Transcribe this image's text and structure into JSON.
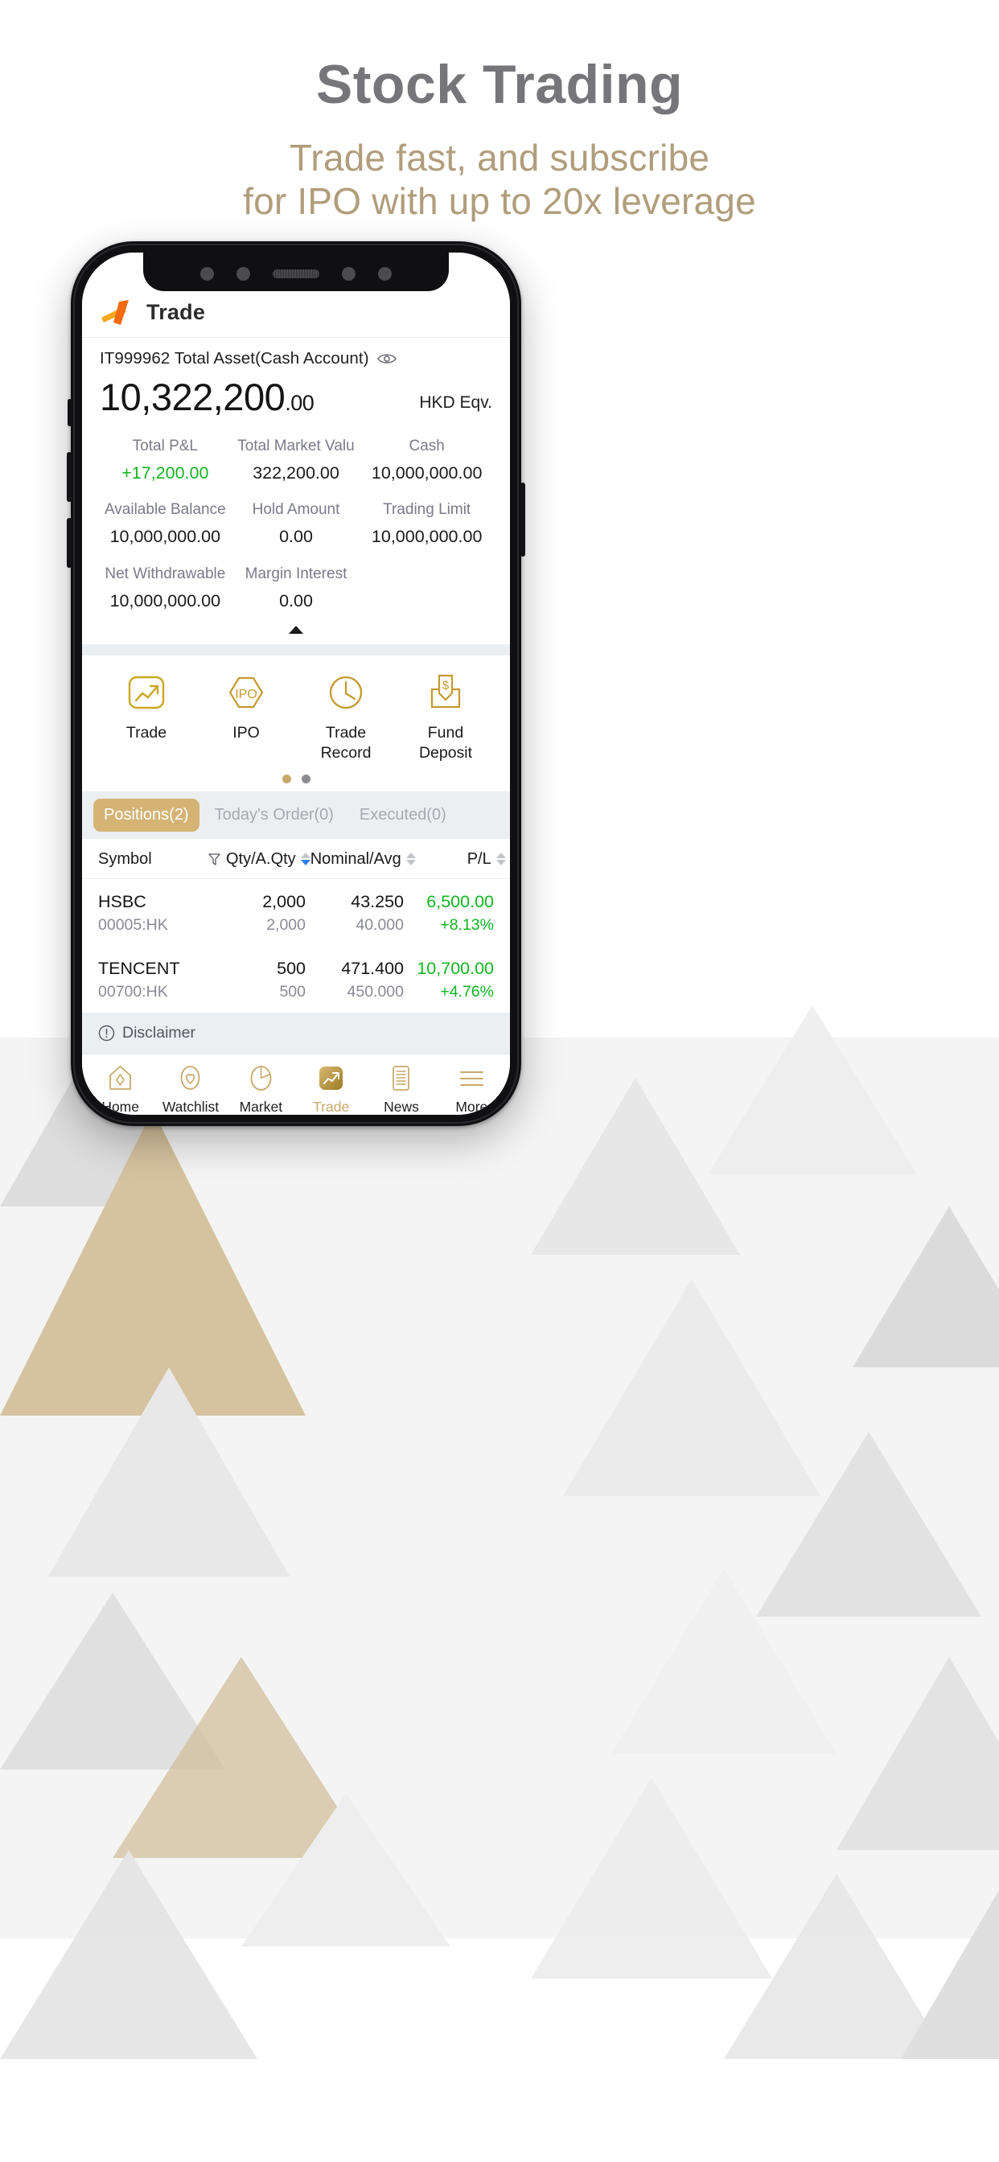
{
  "promo": {
    "title": "Stock Trading",
    "subtitle_line1": "Trade fast, and subscribe",
    "subtitle_line2": "for IPO with up to 20x leverage",
    "title_color": "#76767a",
    "subtitle_color": "#b09d7b"
  },
  "app": {
    "header": {
      "logo_icon": "arrow-logo-icon",
      "title": "Trade"
    },
    "account": {
      "label": "IT999962 Total Asset(Cash Account)",
      "visibility_icon": "eye-icon",
      "balance_whole": "10,322,200",
      "balance_cents": ".00",
      "currency": "HKD Eqv.",
      "stats": [
        {
          "caption": "Total P&L",
          "value": "+17,200.00",
          "positive": true
        },
        {
          "caption": "Total Market Valu",
          "value": "322,200.00",
          "positive": false
        },
        {
          "caption": "Cash",
          "value": "10,000,000.00",
          "positive": false
        },
        {
          "caption": "Available Balance",
          "value": "10,000,000.00",
          "positive": false
        },
        {
          "caption": "Hold Amount",
          "value": "0.00",
          "positive": false
        },
        {
          "caption": "Trading Limit",
          "value": "10,000,000.00",
          "positive": false
        },
        {
          "caption": "Net Withdrawable",
          "value": "10,000,000.00",
          "positive": false
        },
        {
          "caption": "Margin Interest",
          "value": "0.00",
          "positive": false
        },
        {
          "caption": "",
          "value": "",
          "positive": false
        }
      ],
      "collapse_icon": "caret-up-icon"
    },
    "quick_actions": [
      {
        "icon": "trend-up-square-icon",
        "label": "Trade"
      },
      {
        "icon": "ipo-hexagon-icon",
        "label": "IPO"
      },
      {
        "icon": "clock-icon",
        "label": "Trade\nRecord"
      },
      {
        "icon": "fund-deposit-icon",
        "label": "Fund\nDeposit"
      }
    ],
    "pager": {
      "total": 2,
      "active_index": 0
    },
    "tabs": [
      {
        "label": "Positions(2)",
        "active": true
      },
      {
        "label": "Today's Order(0)",
        "active": false
      },
      {
        "label": "Executed(0)",
        "active": false
      }
    ],
    "table": {
      "columns": [
        {
          "label": "Symbol",
          "filter_icon": false,
          "sort": "none"
        },
        {
          "label": "Qty/A.Qty",
          "filter_icon": true,
          "sort": "desc"
        },
        {
          "label": "Nominal/Avg",
          "filter_icon": false,
          "sort": "none"
        },
        {
          "label": "P/L",
          "filter_icon": false,
          "sort": "none"
        }
      ],
      "rows": [
        {
          "symbol": "HSBC",
          "code": "00005:HK",
          "qty": "2,000",
          "a_qty": "2,000",
          "nominal": "43.250",
          "avg": "40.000",
          "pl": "6,500.00",
          "pl_pct": "+8.13%",
          "positive": true
        },
        {
          "symbol": "TENCENT",
          "code": "00700:HK",
          "qty": "500",
          "a_qty": "500",
          "nominal": "471.400",
          "avg": "450.000",
          "pl": "10,700.00",
          "pl_pct": "+4.76%",
          "positive": true
        }
      ]
    },
    "disclaimer": {
      "icon": "exclamation-circle-icon",
      "text": "Disclaimer"
    },
    "bottom_nav": [
      {
        "icon": "home-icon",
        "label": "Home",
        "active": false
      },
      {
        "icon": "heart-icon",
        "label": "Watchlist",
        "active": false
      },
      {
        "icon": "pie-chart-icon",
        "label": "Market",
        "active": false
      },
      {
        "icon": "trend-up-icon",
        "label": "Trade",
        "active": true
      },
      {
        "icon": "news-icon",
        "label": "News",
        "active": false
      },
      {
        "icon": "menu-icon",
        "label": "More",
        "active": false
      }
    ]
  },
  "colors": {
    "gold": "#c9a86a",
    "gold_dark": "#b8932f",
    "tab_active": "#d4b375",
    "positive_green": "#12b521",
    "band_gray": "#eceff1",
    "logo_orange": "#f26a11",
    "logo_amber": "#f5a81c"
  }
}
